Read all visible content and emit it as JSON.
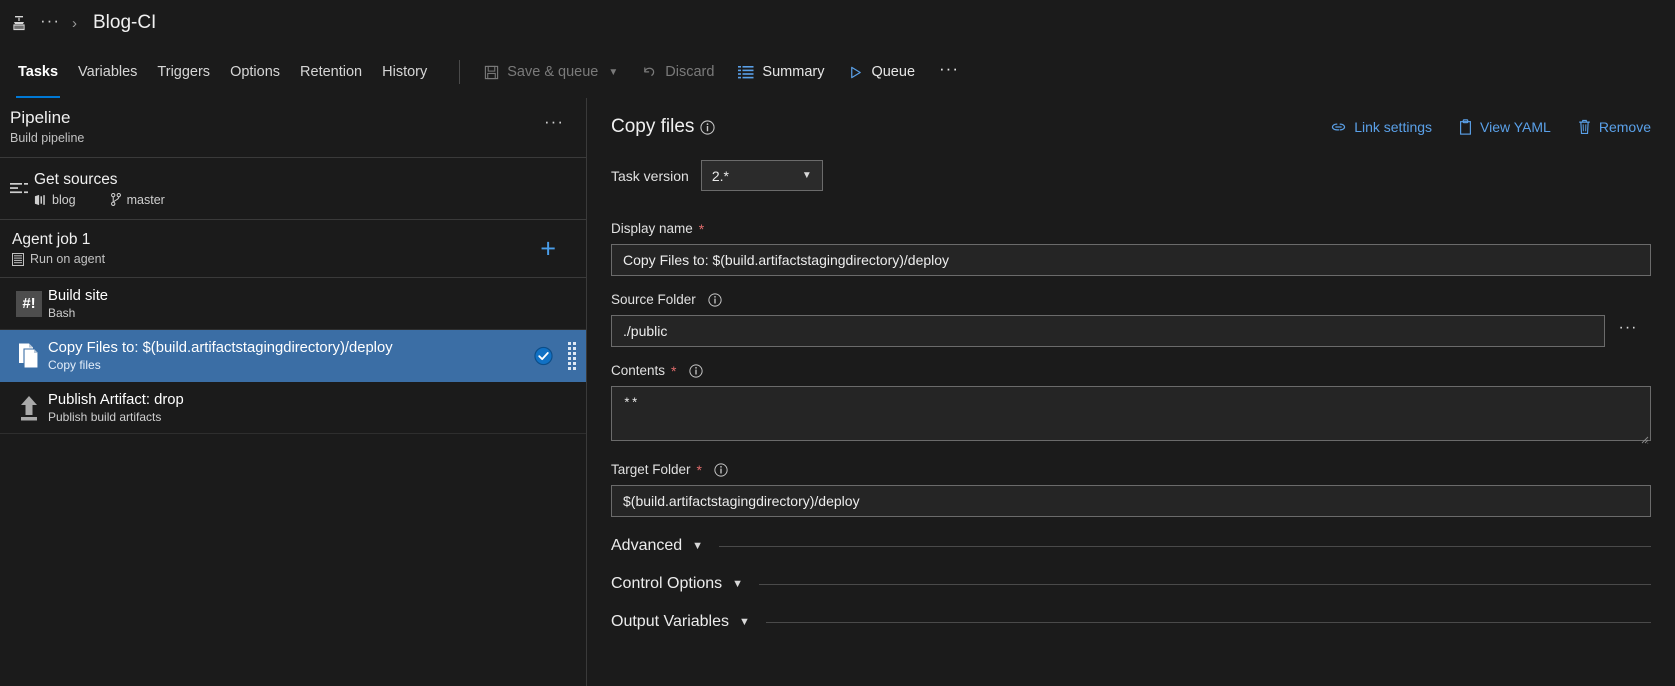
{
  "breadcrumb": {
    "overflow": "···",
    "separator": "›",
    "title": "Blog-CI"
  },
  "tabs": [
    {
      "label": "Tasks",
      "active": true
    },
    {
      "label": "Variables",
      "active": false
    },
    {
      "label": "Triggers",
      "active": false
    },
    {
      "label": "Options",
      "active": false
    },
    {
      "label": "Retention",
      "active": false
    },
    {
      "label": "History",
      "active": false
    }
  ],
  "toolbar": {
    "save_queue_label": "Save & queue",
    "discard_label": "Discard",
    "summary_label": "Summary",
    "queue_label": "Queue",
    "more_label": "···"
  },
  "sidebar": {
    "pipeline": {
      "title": "Pipeline",
      "subtitle": "Build pipeline",
      "more_label": "···"
    },
    "get_sources": {
      "title": "Get sources",
      "repo": "blog",
      "branch": "master"
    },
    "agent_job": {
      "title": "Agent job 1",
      "subtitle": "Run on agent",
      "add_label": "+"
    },
    "tasks": [
      {
        "title": "Build site",
        "subtitle": "Bash",
        "icon": "shebang-icon",
        "icon_text": "#!",
        "selected": false
      },
      {
        "title": "Copy Files to: $(build.artifactstagingdirectory)/deploy",
        "subtitle": "Copy files",
        "icon": "copy-files-icon",
        "selected": true
      },
      {
        "title": "Publish Artifact: drop",
        "subtitle": "Publish build artifacts",
        "icon": "upload-arrow-icon",
        "selected": false
      }
    ]
  },
  "detail": {
    "title": "Copy files",
    "actions": [
      {
        "label": "Link settings",
        "icon": "link-icon"
      },
      {
        "label": "View YAML",
        "icon": "clipboard-icon"
      },
      {
        "label": "Remove",
        "icon": "trash-icon"
      }
    ],
    "task_version": {
      "label": "Task version",
      "value": "2.*"
    },
    "fields": [
      {
        "label": "Display name",
        "required": true,
        "has_info": false,
        "value": "Copy Files to: $(build.artifactstagingdirectory)/deploy",
        "type": "text"
      },
      {
        "label": "Source Folder",
        "required": false,
        "has_info": true,
        "value": "./public",
        "type": "text-browse",
        "browse_label": "···"
      },
      {
        "label": "Contents",
        "required": true,
        "has_info": true,
        "value": "**",
        "type": "textarea"
      },
      {
        "label": "Target Folder",
        "required": true,
        "has_info": true,
        "value": "$(build.artifactstagingdirectory)/deploy",
        "type": "text"
      }
    ],
    "sections": [
      {
        "label": "Advanced"
      },
      {
        "label": "Control Options"
      },
      {
        "label": "Output Variables"
      }
    ]
  },
  "colors": {
    "accent": "#0078d4",
    "link": "#5aa0e8",
    "selected_row": "#3b6ea5",
    "required": "#e06c6c",
    "background": "#1b1b1b"
  }
}
